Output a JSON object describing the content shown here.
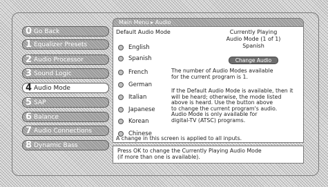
{
  "breadcrumb": "Main Menu ▸ Audio",
  "menu": [
    {
      "num": "0",
      "label": "Go Back"
    },
    {
      "num": "1",
      "label": "Equalizer Presets"
    },
    {
      "num": "2",
      "label": "Audio Processor"
    },
    {
      "num": "3",
      "label": "Sound Logic"
    },
    {
      "num": "4",
      "label": "Audio Mode"
    },
    {
      "num": "5",
      "label": "SAP"
    },
    {
      "num": "6",
      "label": "Balance"
    },
    {
      "num": "7",
      "label": "Audio Connections"
    },
    {
      "num": "8",
      "label": "Dynamic Bass"
    }
  ],
  "active_menu_index": 4,
  "panel": {
    "title": "Default Audio Mode",
    "options": [
      "English",
      "Spanish",
      "French",
      "German",
      "Italian",
      "Japanese",
      "Korean",
      "Chinese"
    ],
    "current": {
      "heading": "Currently Playing",
      "line2": "Audio Mode (1 of 1)",
      "language": "Spanish",
      "button": "Change Audio"
    },
    "info1_line1": "The number of Audio Modes available",
    "info1_line2": "for the current program is 1.",
    "info2_lines": [
      "If the Default Audio Mode is available, then it",
      "will be heard; otherwise, the mode listed",
      "above is heard. Use the button above",
      "to change the current program's audio.",
      "Audio Mode is only available for",
      "digital-TV (ATSC) programs."
    ],
    "note": "A change in this screen is applied to all inputs."
  },
  "hint_line1": "Press OK to change the Currently Playing Audio Mode",
  "hint_line2": "(if more than one is available)."
}
